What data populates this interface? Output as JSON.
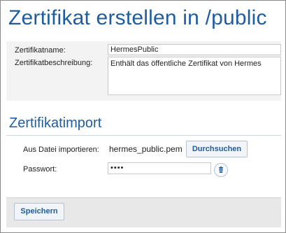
{
  "page": {
    "title": "Zertifikat erstellen in /public"
  },
  "certificate": {
    "name_label": "Zertifikatname:",
    "name_value": "HermesPublic",
    "description_label": "Zertifikatbeschreibung:",
    "description_value": "Enthält das öffentliche Zertifikat von Hermes"
  },
  "import": {
    "section_title": "Zertifikatimport",
    "file_label": "Aus Datei importieren:",
    "file_name": "hermes_public.pem",
    "browse_label": "Durchsuchen",
    "password_label": "Passwort:",
    "password_value": "••••"
  },
  "footer": {
    "save_label": "Speichern"
  },
  "icons": {
    "clear_password": "trash-icon"
  },
  "colors": {
    "accent": "#1f5d9e",
    "panel_bg": "#f3f3f3",
    "footer_bg": "#e8e8e8"
  }
}
